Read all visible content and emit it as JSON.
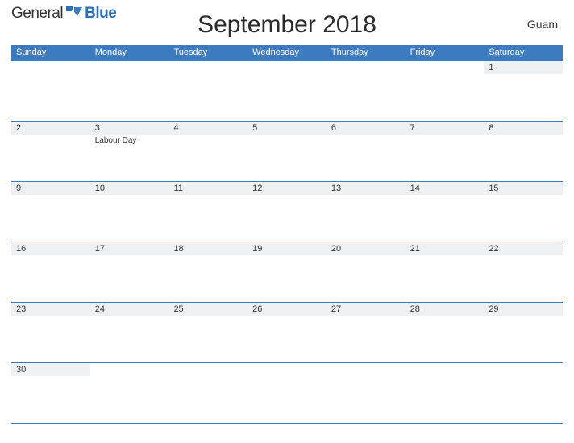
{
  "brand": {
    "part1": "General",
    "part2": "Blue"
  },
  "title": "September 2018",
  "region": "Guam",
  "day_headers": [
    "Sunday",
    "Monday",
    "Tuesday",
    "Wednesday",
    "Thursday",
    "Friday",
    "Saturday"
  ],
  "weeks": [
    [
      {
        "num": "",
        "event": ""
      },
      {
        "num": "",
        "event": ""
      },
      {
        "num": "",
        "event": ""
      },
      {
        "num": "",
        "event": ""
      },
      {
        "num": "",
        "event": ""
      },
      {
        "num": "",
        "event": ""
      },
      {
        "num": "1",
        "event": ""
      }
    ],
    [
      {
        "num": "2",
        "event": ""
      },
      {
        "num": "3",
        "event": "Labour Day"
      },
      {
        "num": "4",
        "event": ""
      },
      {
        "num": "5",
        "event": ""
      },
      {
        "num": "6",
        "event": ""
      },
      {
        "num": "7",
        "event": ""
      },
      {
        "num": "8",
        "event": ""
      }
    ],
    [
      {
        "num": "9",
        "event": ""
      },
      {
        "num": "10",
        "event": ""
      },
      {
        "num": "11",
        "event": ""
      },
      {
        "num": "12",
        "event": ""
      },
      {
        "num": "13",
        "event": ""
      },
      {
        "num": "14",
        "event": ""
      },
      {
        "num": "15",
        "event": ""
      }
    ],
    [
      {
        "num": "16",
        "event": ""
      },
      {
        "num": "17",
        "event": ""
      },
      {
        "num": "18",
        "event": ""
      },
      {
        "num": "19",
        "event": ""
      },
      {
        "num": "20",
        "event": ""
      },
      {
        "num": "21",
        "event": ""
      },
      {
        "num": "22",
        "event": ""
      }
    ],
    [
      {
        "num": "23",
        "event": ""
      },
      {
        "num": "24",
        "event": ""
      },
      {
        "num": "25",
        "event": ""
      },
      {
        "num": "26",
        "event": ""
      },
      {
        "num": "27",
        "event": ""
      },
      {
        "num": "28",
        "event": ""
      },
      {
        "num": "29",
        "event": ""
      }
    ],
    [
      {
        "num": "30",
        "event": ""
      },
      {
        "num": "",
        "event": ""
      },
      {
        "num": "",
        "event": ""
      },
      {
        "num": "",
        "event": ""
      },
      {
        "num": "",
        "event": ""
      },
      {
        "num": "",
        "event": ""
      },
      {
        "num": "",
        "event": ""
      }
    ]
  ]
}
